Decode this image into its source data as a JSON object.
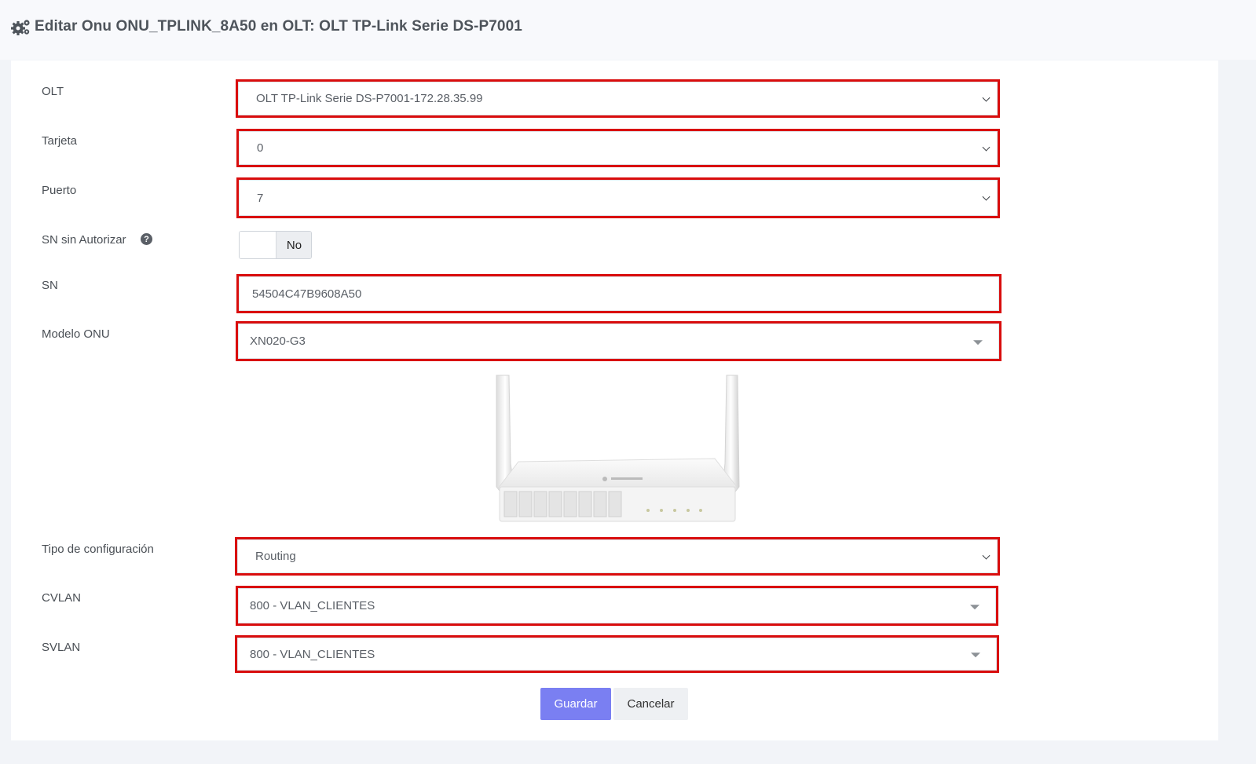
{
  "header": {
    "title": "Editar Onu ONU_TPLINK_8A50 en OLT: OLT TP-Link Serie DS-P7001",
    "icon": "gears-icon"
  },
  "form": {
    "olt": {
      "label": "OLT",
      "value": "OLT TP-Link Serie DS-P7001-172.28.35.99"
    },
    "tarjeta": {
      "label": "Tarjeta",
      "value": "0"
    },
    "puerto": {
      "label": "Puerto",
      "value": "7"
    },
    "sn_sin_autorizar": {
      "label": "SN sin Autorizar",
      "toggle_text": "No",
      "help_icon": "question-circle-icon"
    },
    "sn": {
      "label": "SN",
      "value": "54504C47B9608A50"
    },
    "modelo_onu": {
      "label": "Modelo ONU",
      "value": "XN020-G3"
    },
    "tipo_config": {
      "label": "Tipo de configuración",
      "value": "Routing"
    },
    "cvlan": {
      "label": "CVLAN",
      "value": "800 - VLAN_CLIENTES"
    },
    "svlan": {
      "label": "SVLAN",
      "value": "800 - VLAN_CLIENTES"
    }
  },
  "buttons": {
    "save": "Guardar",
    "cancel": "Cancelar"
  },
  "colors": {
    "highlight": "#d90d0d",
    "primary": "#7a7ff2"
  }
}
